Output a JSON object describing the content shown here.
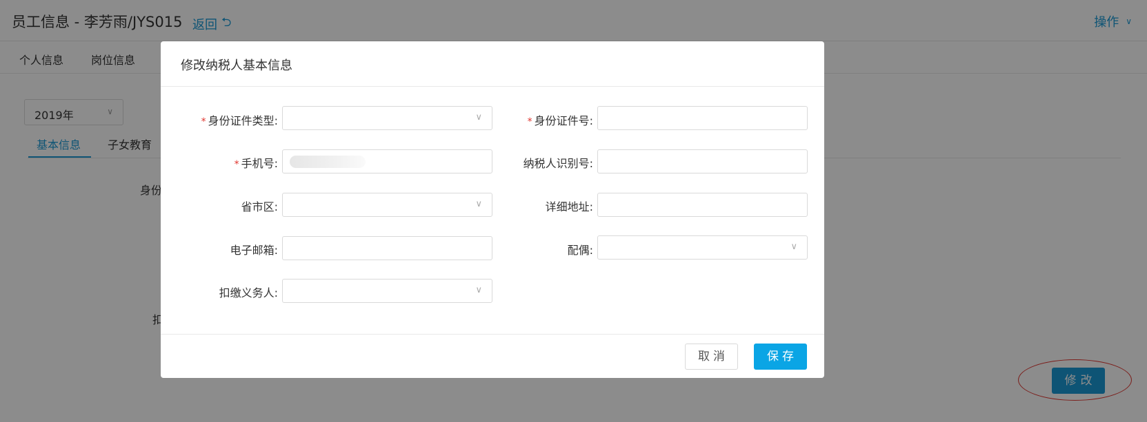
{
  "header": {
    "title": "员工信息 - 李芳雨/JYS015",
    "back_label": "返回",
    "back_icon": "return-icon",
    "ops_label": "操作"
  },
  "main_tabs": [
    {
      "label": "个人信息"
    },
    {
      "label": "岗位信息"
    }
  ],
  "year_select": {
    "value": "2019年"
  },
  "sub_tabs": [
    {
      "label": "基本信息",
      "active": true
    },
    {
      "label": "子女教育",
      "active": false
    }
  ],
  "background_labels": {
    "label_1": "身份",
    "label_2": "扣"
  },
  "modify_button": {
    "label": "修改"
  },
  "colors": {
    "accent": "#1a9ad6",
    "save": "#0aa5e5",
    "required": "#e0342e",
    "overlay": "rgba(0,0,0,0.45)"
  },
  "modal": {
    "title": "修改纳税人基本信息",
    "required_mark": "*",
    "fields": {
      "id_type": {
        "label": "身份证件类型:",
        "required": true,
        "kind": "select",
        "value": ""
      },
      "id_number": {
        "label": "身份证件号:",
        "required": true,
        "kind": "input",
        "value": ""
      },
      "phone": {
        "label": "手机号:",
        "required": true,
        "kind": "input",
        "value": ""
      },
      "taxpayer_id": {
        "label": "纳税人识别号:",
        "required": false,
        "kind": "input",
        "value": ""
      },
      "province": {
        "label": "省市区:",
        "required": false,
        "kind": "select",
        "value": ""
      },
      "address": {
        "label": "详细地址:",
        "required": false,
        "kind": "input",
        "value": ""
      },
      "email": {
        "label": "电子邮箱:",
        "required": false,
        "kind": "input",
        "value": ""
      },
      "spouse": {
        "label": "配偶:",
        "required": false,
        "kind": "select",
        "value": ""
      },
      "withholding_agent": {
        "label": "扣缴义务人:",
        "required": false,
        "kind": "select",
        "value": ""
      }
    },
    "cancel_label": "取消",
    "save_label": "保存"
  }
}
